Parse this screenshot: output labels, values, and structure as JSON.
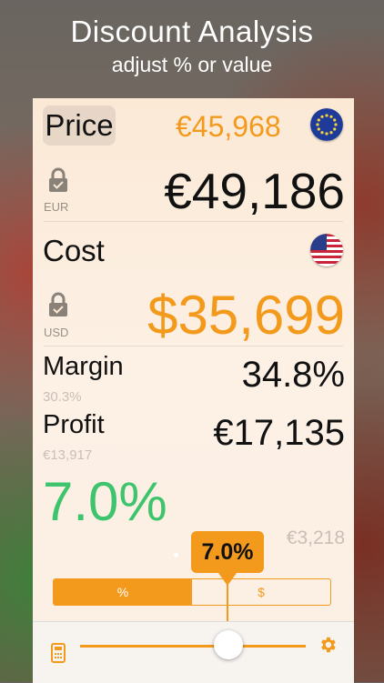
{
  "header": {
    "title": "Discount Analysis",
    "subtitle": "adjust % or value"
  },
  "price": {
    "label": "Price",
    "converted": "€45,968",
    "value": "€49,186",
    "currency": "EUR",
    "flag": "eu-flag-icon"
  },
  "cost": {
    "label": "Cost",
    "value": "$35,699",
    "currency": "USD",
    "flag": "us-flag-icon"
  },
  "margin": {
    "label": "Margin",
    "value": "34.8%",
    "previous": "30.3%"
  },
  "profit": {
    "label": "Profit",
    "value": "€17,135",
    "previous": "€13,917"
  },
  "discount": {
    "percent": "7.0%",
    "amount": "€3,218",
    "bubble": "7.0%",
    "slider_fraction": 0.62
  },
  "segment": {
    "percent_label": "%",
    "value_label": "$",
    "selected": "%"
  },
  "colors": {
    "accent": "#f39a1c",
    "discount_green": "#3ec46d"
  },
  "toolbar": {
    "left_icon": "calculator-icon",
    "right_icon": "gear-icon"
  }
}
